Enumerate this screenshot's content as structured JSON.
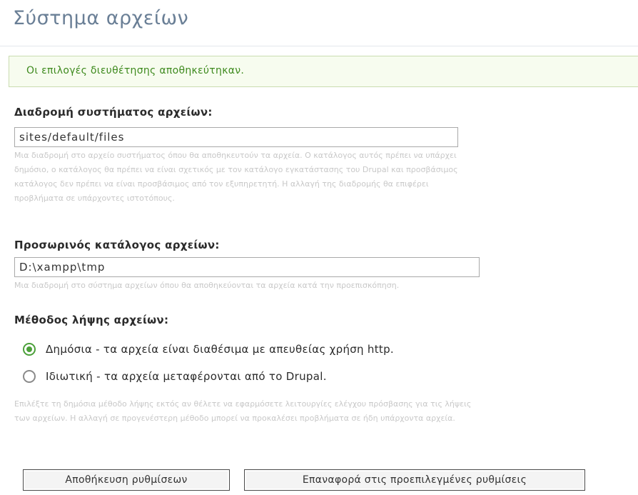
{
  "page": {
    "title": "Σύστημα αρχείων"
  },
  "status": {
    "message": "Οι επιλογές διευθέτησης αποθηκεύτηκαν."
  },
  "file_system_path": {
    "label": "Διαδρομή συστήματος αρχείων:",
    "value": "sites/default/files",
    "help_lines": [
      "Μια διαδρομή στο αρχείο συστήματος όπου θα αποθηκευτούν τα αρχεία. Ο κατάλογος αυτός πρέπει να υπάρχει",
      "δημόσιο, ο κατάλογος θα πρέπει να είναι σχετικός με τον κατάλογο εγκατάστασης του Drupal και προσβάσιμος",
      "κατάλογος δεν πρέπει να είναι προσβάσιμος από τον εξυπηρετητή. Η αλλαγή της διαδρομής θα επιφέρει",
      "προβλήματα σε υπάρχοντες ιστοτόπους."
    ]
  },
  "temp_directory": {
    "label": "Προσωρινός κατάλογος αρχείων:",
    "value": "D:\\xampp\\tmp",
    "help": "Μια διαδρομή στο σύστημα αρχείων όπου θα αποθηκεύονται τα αρχεία κατά την προεπισκόπηση."
  },
  "download_method": {
    "label": "Μέθοδος λήψης αρχείων:",
    "options": [
      {
        "label": "Δημόσια - τα αρχεία είναι διαθέσιμα με απευθείας χρήση http.",
        "checked": true
      },
      {
        "label": "Ιδιωτική - τα αρχεία μεταφέρονται από το Drupal.",
        "checked": false
      }
    ],
    "help_lines": [
      "Επιλέξτε τη δημόσια μέθοδο λήψης εκτός αν θέλετε να εφαρμόσετε λειτουργίες ελέγχου πρόσβασης για τις λήψεις",
      "των αρχείων. Η αλλαγή σε προγενέστερη μέθοδο μπορεί να προκαλέσει προβλήματα σε ήδη υπάρχοντα αρχεία."
    ]
  },
  "buttons": {
    "save": "Αποθήκευση ρυθμίσεων",
    "reset": "Επαναφορά στις προεπιλεγμένες ρυθμίσεις"
  }
}
